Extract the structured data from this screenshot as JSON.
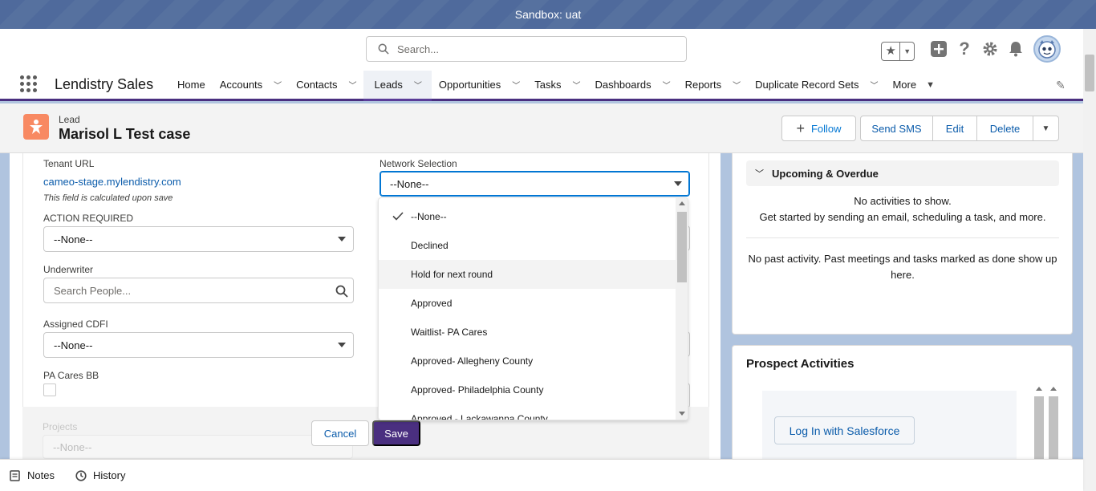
{
  "sandbox": {
    "label": "Sandbox: uat"
  },
  "header": {
    "search_placeholder": "Search...",
    "icons": [
      "star-icon",
      "chevron-down-icon",
      "add-icon",
      "help-icon",
      "gear-icon",
      "bell-icon",
      "avatar"
    ]
  },
  "nav": {
    "app_name": "Lendistry Sales",
    "items": [
      {
        "label": "Home",
        "has_chevron": false
      },
      {
        "label": "Accounts",
        "has_chevron": true
      },
      {
        "label": "Contacts",
        "has_chevron": true
      },
      {
        "label": "Leads",
        "has_chevron": true,
        "active": true
      },
      {
        "label": "Opportunities",
        "has_chevron": true
      },
      {
        "label": "Tasks",
        "has_chevron": true
      },
      {
        "label": "Dashboards",
        "has_chevron": true
      },
      {
        "label": "Reports",
        "has_chevron": true
      },
      {
        "label": "Duplicate Record Sets",
        "has_chevron": true
      }
    ],
    "more_label": "More"
  },
  "record": {
    "type": "Lead",
    "name": "Marisol L Test case",
    "actions": {
      "follow": "Follow",
      "send_sms": "Send SMS",
      "edit": "Edit",
      "delete": "Delete"
    }
  },
  "form": {
    "tenant_url": {
      "label": "Tenant URL",
      "value": "cameo-stage.mylendistry.com",
      "help": "This field is calculated upon save"
    },
    "action_required": {
      "label": "ACTION REQUIRED",
      "value": "--None--"
    },
    "underwriter": {
      "label": "Underwriter",
      "placeholder": "Search People..."
    },
    "assigned_cdfi": {
      "label": "Assigned CDFI",
      "value": "--None--"
    },
    "pa_cares_bb": {
      "label": "PA Cares BB"
    },
    "projects": {
      "label": "Projects",
      "value": "--None--"
    },
    "network_selection": {
      "label": "Network Selection",
      "value": "--None--",
      "options": [
        "--None--",
        "Declined",
        "Hold for next round",
        "Approved",
        "Waitlist- PA Cares",
        "Approved- Allegheny County",
        "Approved- Philadelphia County",
        "Approved - Lackawanna County"
      ],
      "selected_index": 0,
      "hover_index": 2
    },
    "cancel_label": "Cancel",
    "save_label": "Save"
  },
  "activity": {
    "upcoming_title": "Upcoming & Overdue",
    "no_activities": "No activities to show.",
    "get_started": "Get started by sending an email, scheduling a task, and more.",
    "no_past": "No past activity. Past meetings and tasks marked as done show up here."
  },
  "prospect": {
    "title": "Prospect Activities",
    "login_button": "Log In with Salesforce"
  },
  "utility": {
    "notes": "Notes",
    "history": "History"
  },
  "colors": {
    "brand_purple": "#4a2f80",
    "sandbox_blue": "#56719f",
    "link_blue": "#0b5cab",
    "lead_icon": "#f88962"
  }
}
